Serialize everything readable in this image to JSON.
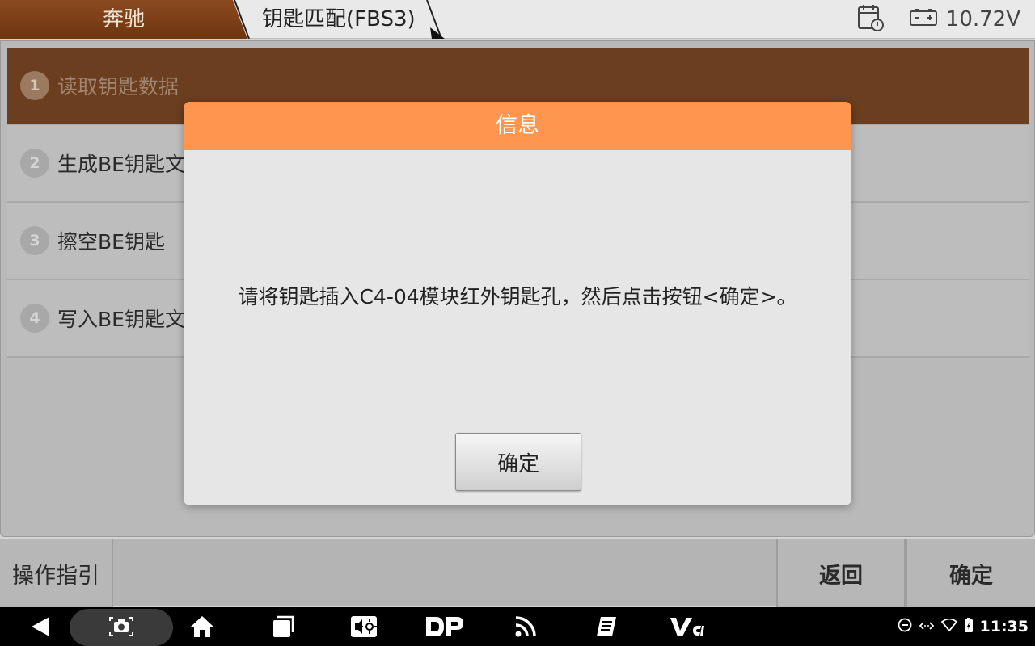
{
  "topbar": {
    "breadcrumb": [
      "奔驰",
      "钥匙匹配(FBS3)"
    ],
    "voltage": "10.72V",
    "icons": [
      "calendar-clock-icon",
      "battery-icon"
    ]
  },
  "steps": [
    {
      "num": "1",
      "label": "读取钥匙数据",
      "active": true
    },
    {
      "num": "2",
      "label": "生成BE钥匙文",
      "active": false
    },
    {
      "num": "3",
      "label": "擦空BE钥匙",
      "active": false
    },
    {
      "num": "4",
      "label": "写入BE钥匙文",
      "active": false
    }
  ],
  "bottombar": {
    "guide_label": "操作指引",
    "back_label": "返回",
    "ok_label": "确定"
  },
  "dialog": {
    "title": "信息",
    "message": "请将钥匙插入C4-04模块红外钥匙孔，然后点击按钮<确定>。",
    "ok_label": "确定"
  },
  "navbar": {
    "time": "11:35",
    "icons": [
      "back-icon",
      "screenshot-camera-icon",
      "home-icon",
      "recent-apps-icon",
      "volume-brightness-icon",
      "dp-logo-icon",
      "feed-icon",
      "manual-book-icon",
      "vci-icon"
    ],
    "status_icons": [
      "dnd-icon",
      "data-sync-icon",
      "wifi-icon",
      "battery-status-icon"
    ]
  },
  "colors": {
    "header_orange": "#ff9650",
    "active_step": "#6b3e1f",
    "crumb_brown": "#7a3b12"
  }
}
